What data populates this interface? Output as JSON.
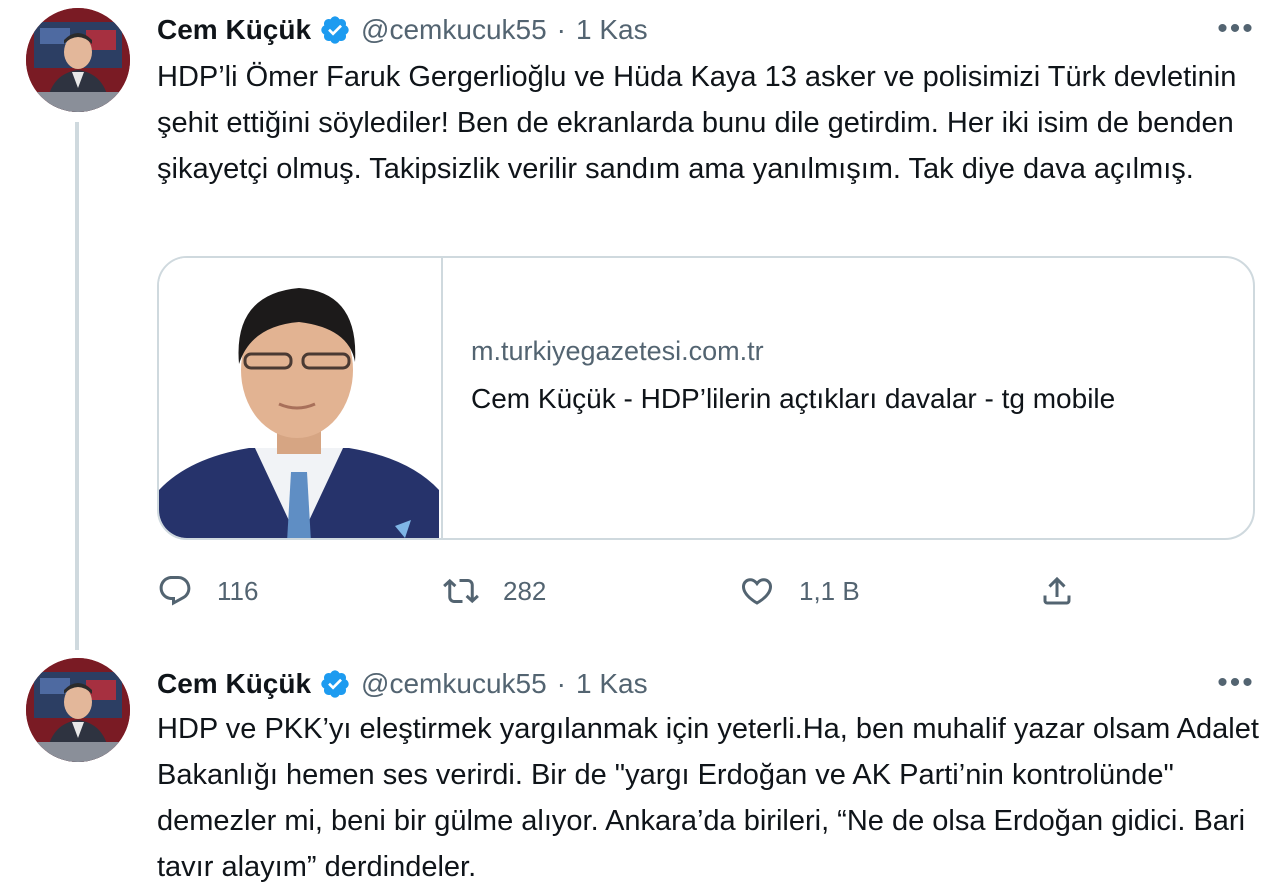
{
  "tweets": [
    {
      "author_name": "Cem Küçük",
      "handle": "@cemkucuk55",
      "separator": "·",
      "time": "1 Kas",
      "more_label": "•••",
      "text": "HDP’li Ömer Faruk Gergerlioğlu ve Hüda Kaya 13 asker ve polisimizi Türk devletinin şehit ettiğini söylediler! Ben de ekranlarda bunu dile getirdim. Her iki isim de benden şikayetçi olmuş. Takipsizlik verilir sandım ama yanılmışım. Tak diye dava açılmış.",
      "card": {
        "domain": "m.turkiyegazetesi.com.tr",
        "title": "Cem Küçük - HDP’lilerin açtıkları davalar - tg mobile"
      },
      "actions": {
        "reply_count": "116",
        "retweet_count": "282",
        "like_count": "1,1 B"
      }
    },
    {
      "author_name": "Cem Küçük",
      "handle": "@cemkucuk55",
      "separator": "·",
      "time": "1 Kas",
      "more_label": "•••",
      "text": "HDP ve PKK’yı eleştirmek yargılanmak için yeterli.Ha, ben muhalif yazar olsam Adalet Bakanlığı hemen ses verirdi. Bir de \"yargı Erdoğan ve AK Parti’nin kontrolünde\" demezler mi, beni bir gülme alıyor. Ankara’da birileri, “Ne de olsa Erdoğan gidici. Bari tavır alayım” derdindeler."
    }
  ],
  "colors": {
    "verified": "#1d9bf0",
    "secondary_text": "#536471",
    "border": "#cfd9de"
  },
  "icons": [
    "verified-badge-icon",
    "more-icon",
    "reply-icon",
    "retweet-icon",
    "like-icon",
    "share-icon"
  ]
}
